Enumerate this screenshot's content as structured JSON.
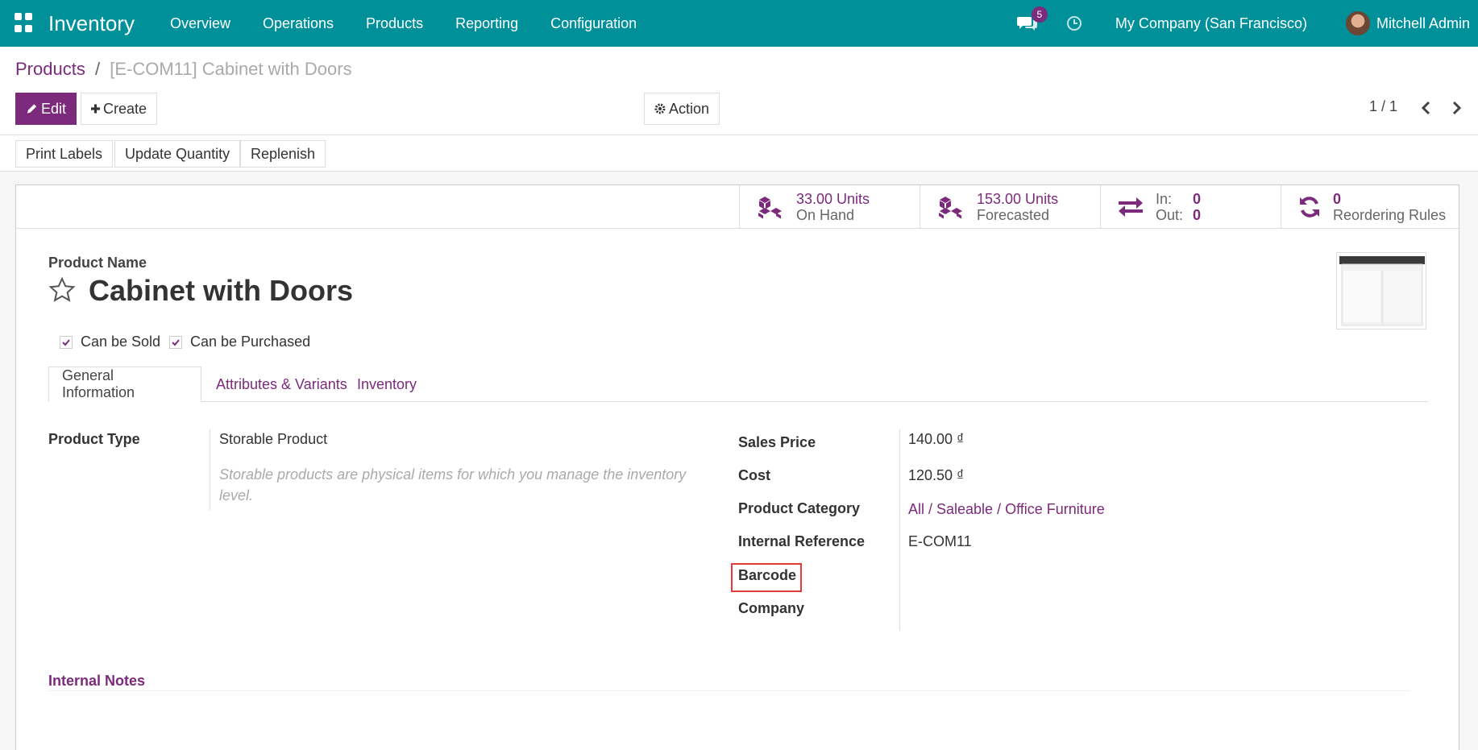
{
  "navbar": {
    "brand": "Inventory",
    "menu": [
      "Overview",
      "Operations",
      "Products",
      "Reporting",
      "Configuration"
    ],
    "chat_count": "5",
    "company": "My Company (San Francisco)",
    "user": "Mitchell Admin"
  },
  "breadcrumb": {
    "parent": "Products",
    "separator": "/",
    "current": "[E-COM11] Cabinet with Doors"
  },
  "toolbar": {
    "edit": "Edit",
    "create": "Create",
    "action": "Action",
    "pager": "1 / 1"
  },
  "status_buttons": [
    "Print Labels",
    "Update Quantity",
    "Replenish"
  ],
  "smart_buttons": {
    "on_hand_value": "33.00 Units",
    "on_hand_label": "On Hand",
    "forecasted_value": "153.00 Units",
    "forecasted_label": "Forecasted",
    "in_label": "In:",
    "in_value": "0",
    "out_label": "Out:",
    "out_value": "0",
    "reordering_value": "0",
    "reordering_label": "Reordering Rules"
  },
  "product": {
    "name_label": "Product Name",
    "name": "Cabinet with Doors",
    "can_be_sold": "Can be Sold",
    "can_be_purchased": "Can be Purchased"
  },
  "tabs": [
    "General Information",
    "Attributes & Variants",
    "Inventory"
  ],
  "fields": {
    "product_type_label": "Product Type",
    "product_type": "Storable Product",
    "product_type_help": "Storable products are physical items for which you manage the inventory level.",
    "sales_price_label": "Sales Price",
    "sales_price": "140.00 ₫",
    "cost_label": "Cost",
    "cost": "120.50 ₫",
    "category_label": "Product Category",
    "category": "All / Saleable / Office Furniture",
    "internal_ref_label": "Internal Reference",
    "internal_ref": "E-COM11",
    "barcode_label": "Barcode",
    "company_label": "Company"
  },
  "notes_label": "Internal Notes",
  "colors": {
    "navbar": "#00909a",
    "primary": "#7c2a7b",
    "highlight": "#e53935"
  }
}
